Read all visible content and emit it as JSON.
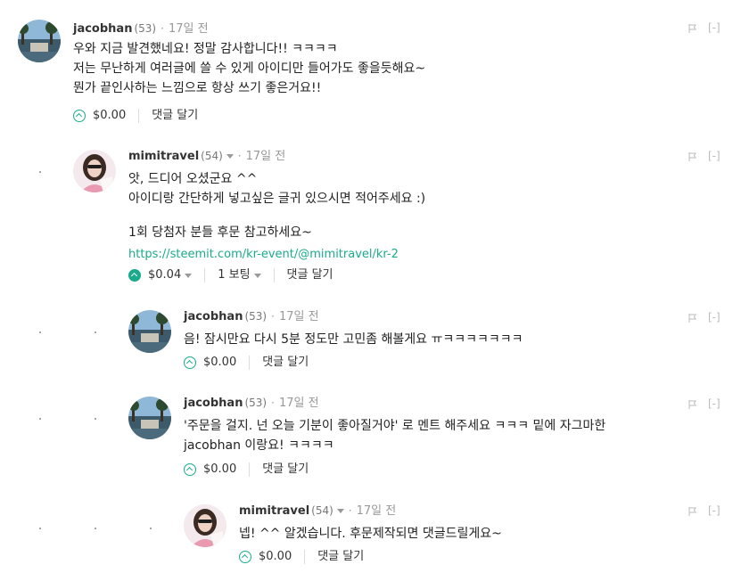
{
  "comments": [
    {
      "author": "jacobhan",
      "rep": "(53)",
      "time": "17일 전",
      "lines": [
        "우와 지금 발견했네요! 정말 감사합니다!! ㅋㅋㅋㅋ",
        "저는 무난하게 여러글에 쓸 수 있게 아이디만 들어가도 좋을듯해요~",
        "뭔가 끝인사하는 느낌으로 항상 쓰기 좋은거요!!"
      ],
      "payout": "$0.00",
      "reply": "댓글 달기",
      "collapse": "[-]"
    },
    {
      "author": "mimitravel",
      "rep": "(54)",
      "time": "17일 전",
      "lines": [
        "앗, 드디어 오셨군요 ^^",
        "아이디랑 간단하게 넣고싶은 글귀 있으시면 적어주세요 :)"
      ],
      "extra_line": "1회 당첨자 분들 후문 참고하세요~",
      "link": "https://steemit.com/kr-event/@mimitravel/kr-2",
      "payout": "$0.04",
      "votes": "1 보팅",
      "reply": "댓글 달기",
      "collapse": "[-]"
    },
    {
      "author": "jacobhan",
      "rep": "(53)",
      "time": "17일 전",
      "lines": [
        "음! 잠시만요 다시 5분 정도만 고민좀 해볼게요 ㅠㅋㅋㅋㅋㅋㅋㅋ"
      ],
      "payout": "$0.00",
      "reply": "댓글 달기",
      "collapse": "[-]"
    },
    {
      "author": "jacobhan",
      "rep": "(53)",
      "time": "17일 전",
      "lines": [
        "'주문을 걸지. 넌 오늘 기분이 좋아질거야' 로 멘트 해주세요 ㅋㅋㅋ 밑에 자그마한",
        "jacobhan 이랑요! ㅋㅋㅋㅋ"
      ],
      "payout": "$0.00",
      "reply": "댓글 달기",
      "collapse": "[-]"
    },
    {
      "author": "mimitravel",
      "rep": "(54)",
      "time": "17일 전",
      "lines": [
        "넵! ^^ 알겠습니다. 후문제작되면 댓글드릴게요~"
      ],
      "payout": "$0.00",
      "reply": "댓글 달기",
      "collapse": "[-]"
    }
  ],
  "colors": {
    "accent": "#1aaa8c",
    "muted": "#999999"
  },
  "icons": [
    "upvote-icon",
    "flag-icon",
    "caret-down-icon"
  ]
}
